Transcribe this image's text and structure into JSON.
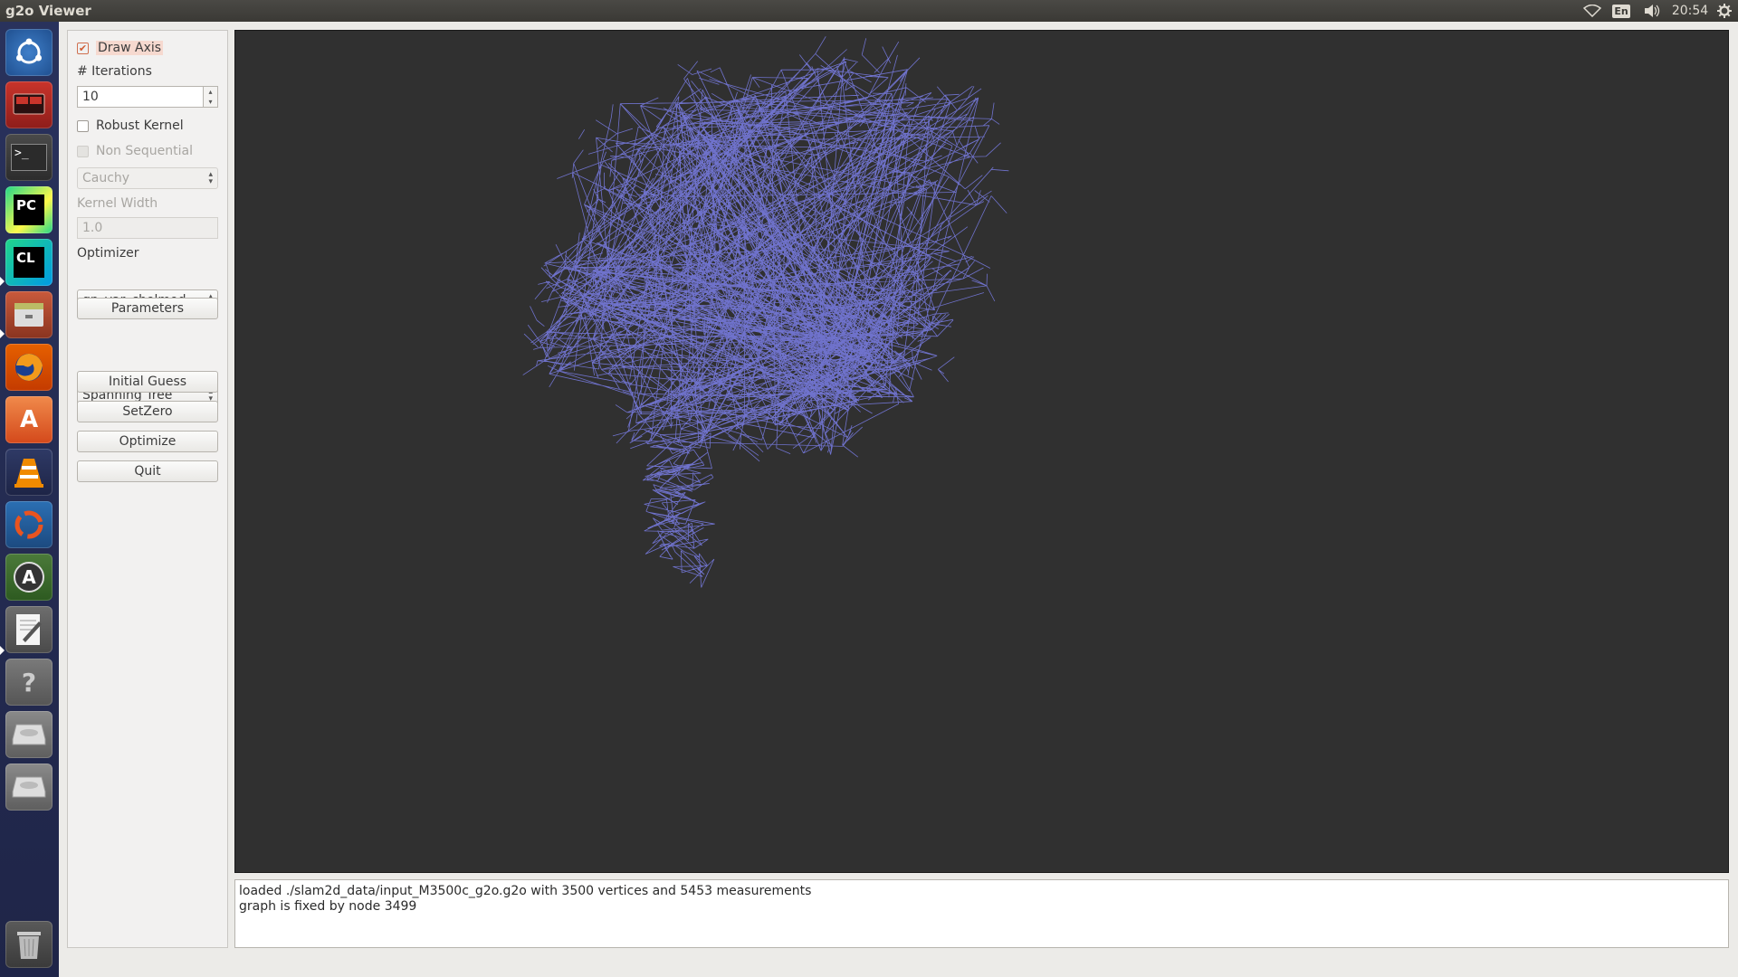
{
  "window": {
    "title": "g2o Viewer"
  },
  "top_panel": {
    "keyboard_layout": "En",
    "clock": "20:54",
    "icons": [
      "wifi-icon",
      "keyboard-layout-icon",
      "volume-icon",
      "settings-gear-icon"
    ]
  },
  "launcher": {
    "items": [
      {
        "name": "ubuntu-dash-icon"
      },
      {
        "name": "remote-desktop-icon"
      },
      {
        "name": "terminal-icon",
        "glyph": ">_"
      },
      {
        "name": "pycharm-icon",
        "glyph": "PC"
      },
      {
        "name": "clion-icon",
        "glyph": "CL"
      },
      {
        "name": "file-manager-icon"
      },
      {
        "name": "firefox-icon"
      },
      {
        "name": "software-center-icon",
        "glyph": "A"
      },
      {
        "name": "vlc-icon"
      },
      {
        "name": "ubuntu-one-icon"
      },
      {
        "name": "software-updater-icon",
        "glyph": "A"
      },
      {
        "name": "text-editor-icon"
      },
      {
        "name": "help-icon",
        "glyph": "?"
      },
      {
        "name": "drive-icon"
      },
      {
        "name": "drive-icon"
      },
      {
        "name": "trash-icon"
      }
    ]
  },
  "controls": {
    "draw_axis": {
      "label": "Draw Axis",
      "checked": true
    },
    "iterations_label": "# Iterations",
    "iterations_value": "10",
    "robust_kernel": {
      "label": "Robust Kernel",
      "checked": false
    },
    "non_sequential": {
      "label": "Non Sequential",
      "checked": false,
      "enabled": false
    },
    "kernel_type": "Cauchy",
    "kernel_width_label": "Kernel Width",
    "kernel_width_value": "1.0",
    "optimizer_label": "Optimizer",
    "optimizer_value": "gn_var_cholmod",
    "parameters_button": "Parameters",
    "initial_guess_type": "Spanning Tree",
    "initial_guess_button": "Initial Guess",
    "setzero_button": "SetZero",
    "optimize_button": "Optimize",
    "quit_button": "Quit"
  },
  "viewer": {
    "background": "#303030",
    "graph_color": "#7a7ee8"
  },
  "log": {
    "lines": [
      "loaded ./slam2d_data/input_M3500c_g2o.g2o with 3500 vertices and 5453 measurements",
      "graph is fixed by node 3499"
    ]
  },
  "colors": {
    "top_panel": "#3c3b37",
    "launcher": "#252c52",
    "accent": "#dd4814"
  }
}
